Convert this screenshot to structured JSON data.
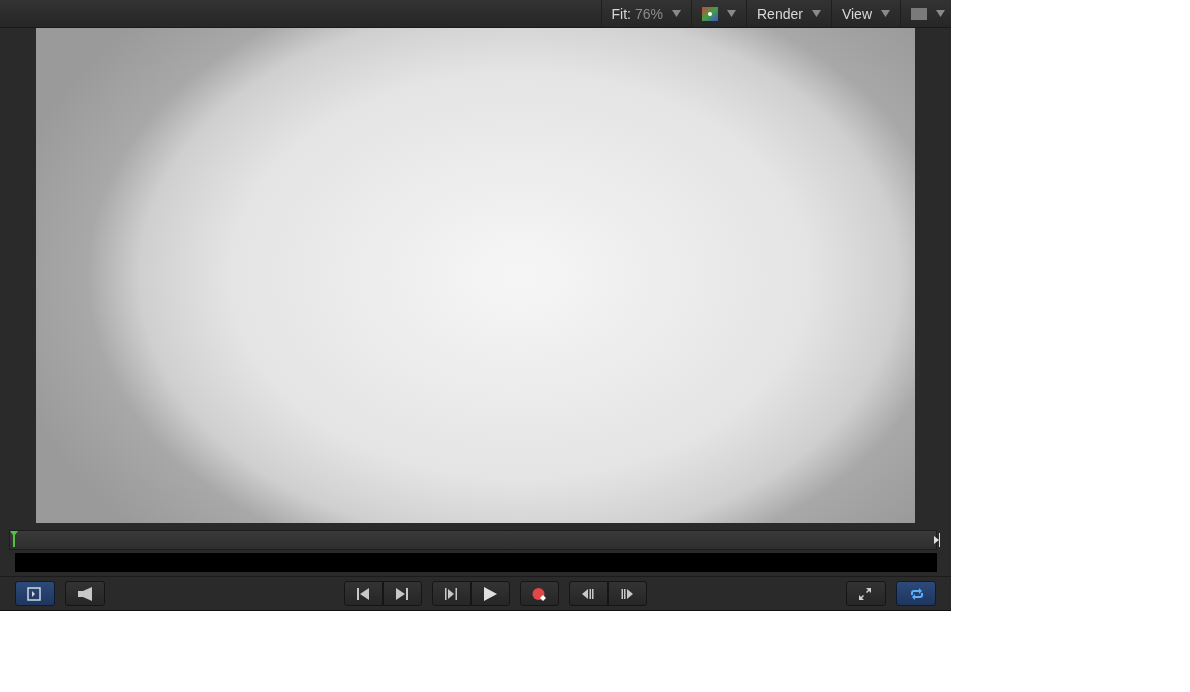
{
  "toolbar": {
    "fit_label": "Fit:",
    "fit_value": "76%",
    "menus": [
      {
        "label": "Render"
      },
      {
        "label": "View"
      }
    ]
  },
  "timeline": {
    "level": 0
  },
  "controls": {
    "left": [
      {
        "kind": "layers",
        "on": true
      },
      {
        "kind": "audio",
        "on": false
      }
    ],
    "transport": [
      {
        "buttons": [
          {
            "kind": "start"
          },
          {
            "kind": "end"
          }
        ]
      },
      {
        "buttons": [
          {
            "kind": "play-from"
          },
          {
            "kind": "play"
          }
        ]
      },
      {
        "buttons": [
          {
            "kind": "record"
          }
        ]
      },
      {
        "buttons": [
          {
            "kind": "prev-frame"
          },
          {
            "kind": "next-frame"
          }
        ]
      }
    ],
    "right": [
      {
        "kind": "fullscreen",
        "on": false
      },
      {
        "kind": "loop",
        "on": true
      }
    ]
  }
}
